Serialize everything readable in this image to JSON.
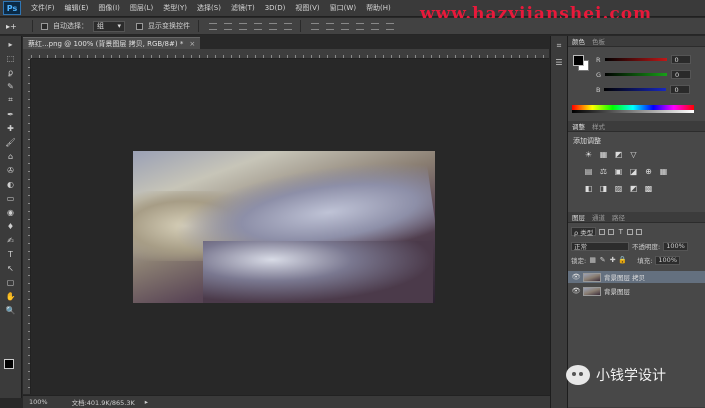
{
  "app": {
    "logo": "Ps"
  },
  "menu": [
    "文件(F)",
    "编辑(E)",
    "图像(I)",
    "图层(L)",
    "类型(Y)",
    "选择(S)",
    "滤镜(T)",
    "3D(D)",
    "视图(V)",
    "窗口(W)",
    "帮助(H)"
  ],
  "watermark": "www.hazyiianshei.com",
  "options": {
    "tool_glyph": "▸+",
    "auto_select_label": "自动选择：",
    "auto_select_value": "组",
    "show_transform_label": "显示变换控件"
  },
  "document": {
    "tab_title": "蔡红...png @ 100% (背景图层 拷贝, RGB/8#) *",
    "close": "×"
  },
  "status": {
    "zoom": "100%",
    "doc_info": "文档:401.9K/865.3K"
  },
  "tools": [
    "▸",
    "⬚",
    "ϼ",
    "✎",
    "⌗",
    "✒",
    "✚",
    "🖌",
    "⌂",
    "✇",
    "◐",
    "▭",
    "◉",
    "♦",
    "✍",
    "T",
    "↖",
    "▢",
    "✋",
    "🔍"
  ],
  "panels": {
    "color": {
      "tabs": [
        "颜色",
        "色板"
      ],
      "sliders": [
        {
          "label": "R",
          "value": "0",
          "color": "#c01818"
        },
        {
          "label": "G",
          "value": "0",
          "color": "#18a018"
        },
        {
          "label": "B",
          "value": "0",
          "color": "#1828c0"
        }
      ]
    },
    "adjustments": {
      "tabs": [
        "调整",
        "样式"
      ],
      "title": "添加调整",
      "icons_row1": [
        "☀",
        "▦",
        "◩",
        "▽"
      ],
      "icons_row2": [
        "▤",
        "⚖",
        "▣",
        "◪",
        "⊕",
        "▦"
      ],
      "icons_row3": [
        "◧",
        "◨",
        "▨",
        "◩",
        "▩"
      ]
    },
    "layers": {
      "tabs": [
        "图层",
        "通道",
        "路径"
      ],
      "filter_label": "ρ 类型",
      "blend_mode": "正常",
      "opacity_label": "不透明度:",
      "opacity_value": "100%",
      "lock_label": "锁定:",
      "fill_label": "填充:",
      "fill_value": "100%",
      "items": [
        {
          "name": "背景图层 拷贝",
          "selected": true
        },
        {
          "name": "背景图层",
          "selected": false
        }
      ]
    }
  },
  "wechat_caption": "小钱学设计"
}
